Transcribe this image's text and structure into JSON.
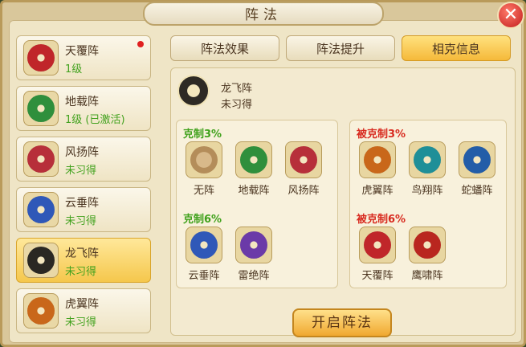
{
  "window": {
    "title": "阵法",
    "close": "✕"
  },
  "tabs": [
    {
      "label": "阵法效果",
      "active": false
    },
    {
      "label": "阵法提升",
      "active": false
    },
    {
      "label": "相克信息",
      "active": true
    }
  ],
  "formation_list": [
    {
      "name": "天覆阵",
      "status": "1级",
      "color": "#c0262a",
      "selected": false,
      "alert": true
    },
    {
      "name": "地载阵",
      "status": "1级 (已激活)",
      "color": "#2f8f3c",
      "selected": false,
      "alert": false
    },
    {
      "name": "风扬阵",
      "status": "未习得",
      "color": "#b72f3a",
      "selected": false,
      "alert": false
    },
    {
      "name": "云垂阵",
      "status": "未习得",
      "color": "#2f58b8",
      "selected": false,
      "alert": false
    },
    {
      "name": "龙飞阵",
      "status": "未习得",
      "color": "#2a2823",
      "selected": true,
      "alert": false
    },
    {
      "name": "虎翼阵",
      "status": "未习得",
      "color": "#c9671a",
      "selected": false,
      "alert": false
    }
  ],
  "current": {
    "name": "龙飞阵",
    "status": "未习得",
    "icon": "dragon-formation-icon"
  },
  "counters": {
    "restrain_3_label": "克制3%",
    "restrain_3": [
      {
        "name": "无阵",
        "icon": "lock-icon",
        "color": "#c8a06a"
      },
      {
        "name": "地载阵",
        "icon": "earth-formation-icon",
        "color": "#2f8f3c"
      },
      {
        "name": "风扬阵",
        "icon": "wind-formation-icon",
        "color": "#b72f3a"
      }
    ],
    "restrain_6_label": "克制6%",
    "restrain_6": [
      {
        "name": "云垂阵",
        "icon": "cloud-formation-icon",
        "color": "#2f58b8"
      },
      {
        "name": "雷绝阵",
        "icon": "thunder-formation-icon",
        "color": "#6b3aa8"
      }
    ],
    "restrained_3_label": "被克制3%",
    "restrained_3": [
      {
        "name": "虎翼阵",
        "icon": "tiger-formation-icon",
        "color": "#c9671a"
      },
      {
        "name": "鸟翔阵",
        "icon": "bird-formation-icon",
        "color": "#1f8f98"
      },
      {
        "name": "蛇蟠阵",
        "icon": "snake-formation-icon",
        "color": "#235da8"
      }
    ],
    "restrained_6_label": "被克制6%",
    "restrained_6": [
      {
        "name": "天覆阵",
        "icon": "heaven-formation-icon",
        "color": "#c0262a"
      },
      {
        "name": "鹰啸阵",
        "icon": "eagle-formation-icon",
        "color": "#b9261f"
      }
    ]
  },
  "start_button": "开启阵法"
}
